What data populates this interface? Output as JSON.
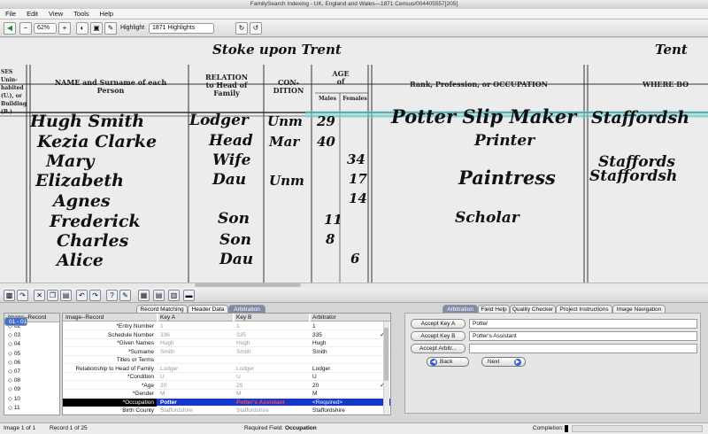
{
  "window": {
    "title": "FamilySearch Indexing - UK, England and Wales—1871 Census/004405557[205]"
  },
  "menu": [
    "File",
    "Edit",
    "View",
    "Tools",
    "Help"
  ],
  "toolbar": {
    "zoom": "62%",
    "highlight_label": "Highlight",
    "highlight_value": "1871 Highlights"
  },
  "image": {
    "top_left_text": "Stoke upon Trent",
    "top_right_text": "Tent",
    "headers": {
      "houses": [
        "SES",
        "Unin-",
        "habited",
        "(U.), or",
        "Building",
        "(B.)"
      ],
      "name": [
        "NAME and Surname of each",
        "Person"
      ],
      "relation": [
        "RELATION",
        "to Head of",
        "Family"
      ],
      "condition": [
        "CON-",
        "DITION"
      ],
      "age": [
        "AGE",
        "of"
      ],
      "males": "Males",
      "females": "Females",
      "occupation": "Rank, Profession, or OCCUPATION",
      "where": "WHERE BO"
    },
    "rows": [
      {
        "name": "Hugh Smith",
        "rel": "Lodger",
        "cond": "Unm",
        "male": "29",
        "female": "",
        "occ": "Potter Slip Maker",
        "born": "Staffordsh"
      },
      {
        "name": "Kezia Clarke",
        "rel": "Head",
        "cond": "Mar",
        "male": "40",
        "female": "",
        "occ": "Printer",
        "born": ""
      },
      {
        "name": "Mary",
        "rel": "Wife",
        "cond": "",
        "male": "",
        "female": "34",
        "occ": "",
        "born": "Staffords"
      },
      {
        "name": "Elizabeth",
        "rel": "Dau",
        "cond": "Unm",
        "male": "",
        "female": "17",
        "occ": "Paintress",
        "born": "Staffordsh"
      },
      {
        "name": "Agnes",
        "rel": "",
        "cond": "",
        "male": "",
        "female": "14",
        "occ": "",
        "born": ""
      },
      {
        "name": "Frederick",
        "rel": "Son",
        "cond": "",
        "male": "11",
        "female": "",
        "occ": "Scholar",
        "born": ""
      },
      {
        "name": "Charles",
        "rel": "Son",
        "cond": "",
        "male": "8",
        "female": "",
        "occ": "",
        "born": ""
      },
      {
        "name": "Alice",
        "rel": "Dau",
        "cond": "",
        "male": "",
        "female": "6",
        "occ": "",
        "born": ""
      }
    ]
  },
  "tabs_left": [
    "Record Matching",
    "Header Data",
    "Arbitration"
  ],
  "tabs_right": [
    "Arbitration",
    "Field Help",
    "Quality Checker",
    "Project Instructions",
    "Image Navigation"
  ],
  "image_records": {
    "header": "Image--Record",
    "rows": [
      "01 - 01",
      "02",
      "03",
      "04",
      "05",
      "06",
      "07",
      "08",
      "09",
      "10",
      "11"
    ]
  },
  "grid": {
    "headers": [
      "Image--Record",
      "Key A",
      "Key B",
      "Arbitrator"
    ],
    "rows": [
      {
        "label": "*Entry Number",
        "a": "1",
        "b": "1",
        "c": "1",
        "check": ""
      },
      {
        "label": "Schedule Number",
        "a": "336",
        "b": "335",
        "c": "335",
        "check": "✓"
      },
      {
        "label": "*Given Names",
        "a": "Hugh",
        "b": "Hugh",
        "c": "Hugh",
        "check": ""
      },
      {
        "label": "*Surname",
        "a": "Smith",
        "b": "Smith",
        "c": "Smith",
        "check": ""
      },
      {
        "label": "Titles or Terms",
        "a": "",
        "b": "",
        "c": "",
        "check": ""
      },
      {
        "label": "Relationship to Head of Family",
        "a": "Lodger",
        "b": "Lodger",
        "c": "Lodger",
        "check": ""
      },
      {
        "label": "*Condition",
        "a": "U",
        "b": "U",
        "c": "U",
        "check": ""
      },
      {
        "label": "*Age",
        "a": "20",
        "b": "29",
        "c": "20",
        "check": "✓"
      },
      {
        "label": "*Gender",
        "a": "M",
        "b": "M",
        "c": "M",
        "check": ""
      },
      {
        "label": "*Occupation",
        "a": "Potter",
        "b": "Potter's Assistant",
        "c": "<Required>",
        "check": ""
      },
      {
        "label": "Birth County",
        "a": "Staffordshire",
        "b": "Staffordshire",
        "c": "Staffordshire",
        "check": ""
      }
    ]
  },
  "arbitration": {
    "accept_a": "Accept Key A",
    "accept_b": "Accept Key B",
    "accept_arb": "Accept Arbitr...",
    "value_a": "Potter",
    "value_b": "Potter's Assistant",
    "value_arb": "",
    "back": "Back",
    "next": "Next"
  },
  "status": {
    "image": "Image 1 of 1",
    "record": "Record 1 of 25",
    "required_label": "Required Field:",
    "required_value": "Occupation",
    "completion_label": "Completion:"
  }
}
